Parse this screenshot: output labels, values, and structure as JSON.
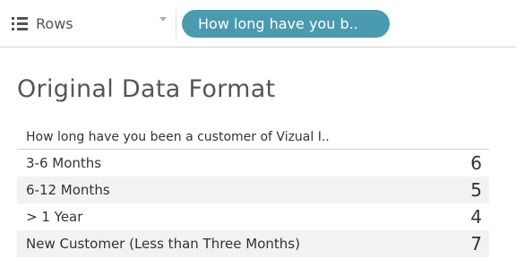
{
  "shelf": {
    "label": "Rows",
    "icon": "rows-icon",
    "pill": {
      "label": "How long have you b..",
      "color": "#4a9ab0"
    }
  },
  "sheet": {
    "title": "Original Data Format"
  },
  "table": {
    "header": "How long have you been a customer of Vizual I..",
    "rows": [
      {
        "label": "3-6 Months",
        "value": "6"
      },
      {
        "label": "6-12 Months",
        "value": "5"
      },
      {
        "label": "> 1 Year",
        "value": "4"
      },
      {
        "label": "New Customer (Less than Three Months)",
        "value": "7"
      }
    ]
  }
}
